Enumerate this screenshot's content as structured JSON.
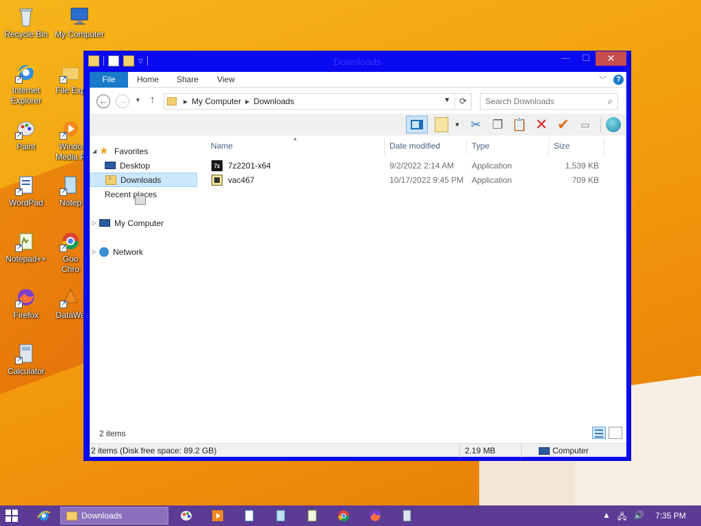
{
  "desktop": {
    "icons": [
      {
        "label": "Recycle Bin"
      },
      {
        "label": "My Computer"
      },
      {
        "label": "Internet Explorer"
      },
      {
        "label": "File Exp"
      },
      {
        "label": "Paint"
      },
      {
        "label": "Windo Media P"
      },
      {
        "label": "WordPad"
      },
      {
        "label": "Notep"
      },
      {
        "label": "Notepad++"
      },
      {
        "label": "Goo Chro"
      },
      {
        "label": "Firefox"
      },
      {
        "label": "DataWa"
      },
      {
        "label": "Calculator"
      }
    ]
  },
  "window": {
    "title": "Downloads",
    "controls": {
      "minimize": "—",
      "maximize": "☐",
      "close": "✕"
    }
  },
  "ribbon": {
    "tabs": [
      "File",
      "Home",
      "Share",
      "View"
    ]
  },
  "address": {
    "crumbs": [
      "My Computer",
      "Downloads"
    ],
    "search_placeholder": "Search Downloads"
  },
  "nav": {
    "favorites": "Favorites",
    "desktop": "Desktop",
    "downloads": "Downloads",
    "recent": "Recent places",
    "computer": "My Computer",
    "network": "Network"
  },
  "columns": {
    "name": "Name",
    "date": "Date modified",
    "type": "Type",
    "size": "Size"
  },
  "files": [
    {
      "name": "7z2201-x64",
      "date": "9/2/2022 2:14 AM",
      "type": "Application",
      "size": "1,539 KB",
      "icon": "7zip-icon"
    },
    {
      "name": "vac467",
      "date": "10/17/2022 9:45 PM",
      "type": "Application",
      "size": "709 KB",
      "icon": "app-icon"
    }
  ],
  "footer": {
    "item_count": "2 items",
    "status_left": "2 items (Disk free space: 89.2 GB)",
    "status_size": "2.19 MB",
    "status_location": "Computer"
  },
  "taskbar": {
    "active_label": "Downloads",
    "clock": "7:35 PM"
  },
  "colors": {
    "window_frame": "#0a0af0",
    "file_tab": "#1979ca",
    "taskbar": "#5b3b94",
    "close_button": "#c74c4c"
  }
}
